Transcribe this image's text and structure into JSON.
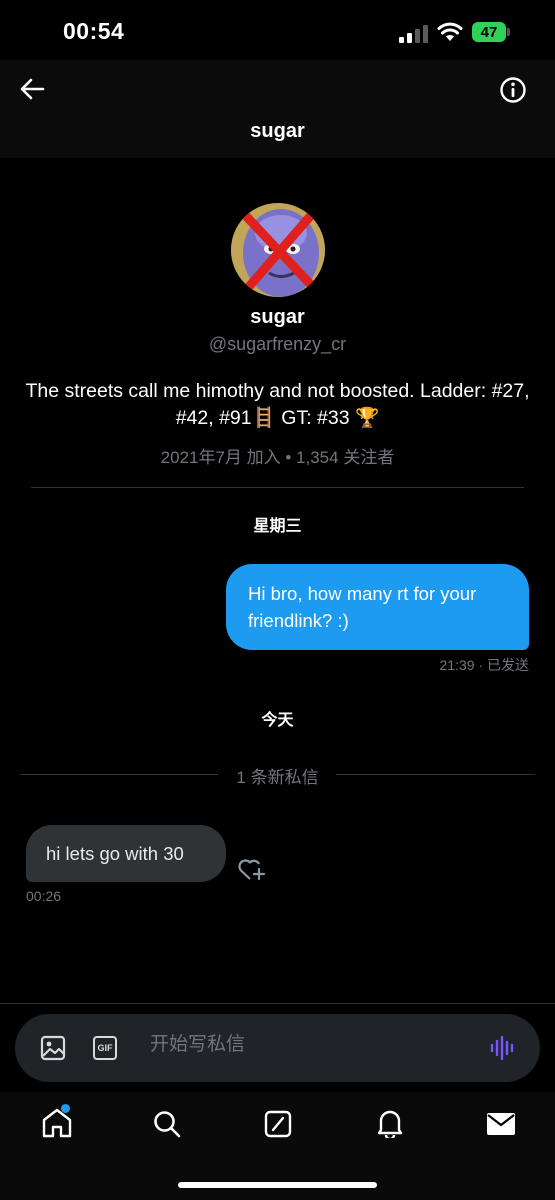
{
  "status_bar": {
    "time": "00:54",
    "battery": "47"
  },
  "header": {
    "title": "sugar",
    "back_icon": "arrow-left-icon",
    "info_icon": "info-icon"
  },
  "profile": {
    "name": "sugar",
    "handle": "@sugarfrenzy_cr",
    "bio": "The streets call me himothy and not boosted. Ladder: #27, #42, #91🪜 GT: #33 🏆",
    "meta": "2021年7月 加入 • 1,354 关注者"
  },
  "conversation": {
    "day1": "星期三",
    "outgoing": {
      "text": "Hi bro, how many rt for your friendlink? :)",
      "time": "21:39 · 已发送"
    },
    "day2": "今天",
    "new_messages": "1 条新私信",
    "incoming": {
      "text": "hi lets go with 30",
      "time": "00:26"
    }
  },
  "composer": {
    "placeholder": "开始写私信",
    "image_icon": "image-icon",
    "gif_label": "GIF",
    "voice_icon": "voice-icon"
  },
  "tabbar": [
    "home-icon",
    "search-icon",
    "grok-icon",
    "notifications-icon",
    "messages-icon"
  ],
  "colors": {
    "accent": "#1d9bf0",
    "voice": "#7856ff",
    "notification_dot": "#1d9bf0"
  }
}
